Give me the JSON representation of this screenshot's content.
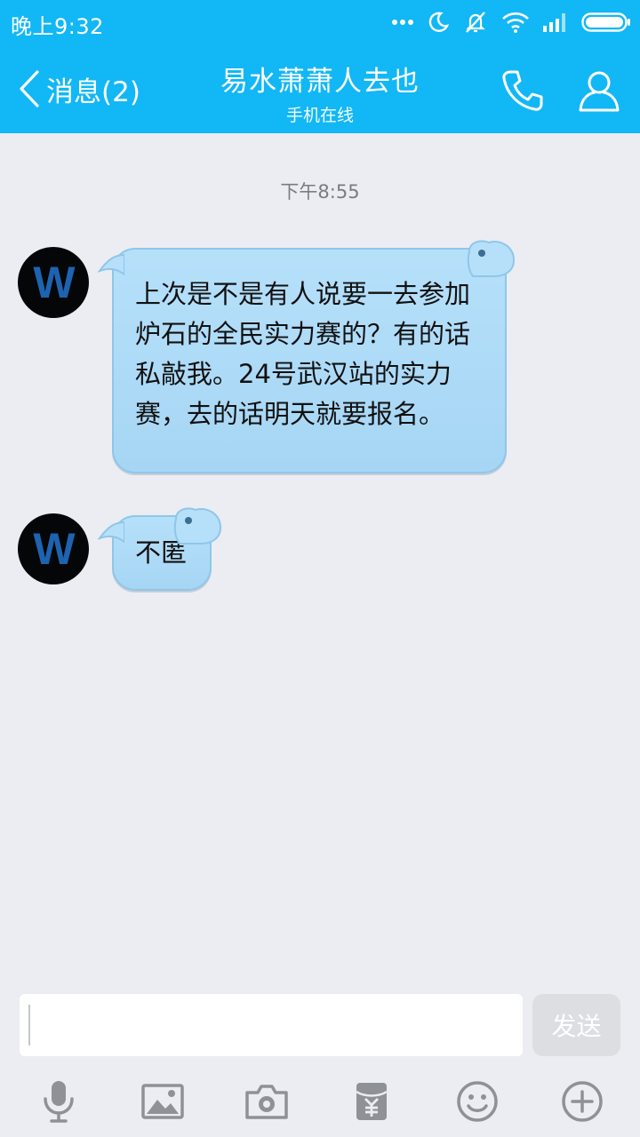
{
  "status_bar": {
    "time": "晚上9:32"
  },
  "header": {
    "back_label": "消息(2)",
    "title": "易水萧萧人去也",
    "subtitle": "手机在线"
  },
  "chat": {
    "timestamp": "下午8:55",
    "messages": [
      {
        "sender_initial": "W",
        "text": "上次是不是有人说要一去参加炉石的全民实力赛的？有的话私敲我。24号武汉站的实力赛，去的话明天就要报名。"
      },
      {
        "sender_initial": "W",
        "text": "不匿"
      }
    ]
  },
  "composer": {
    "input_value": "",
    "send_label": "发送"
  },
  "toolbar": {
    "items": [
      "microphone-icon",
      "image-icon",
      "camera-icon",
      "red-packet-icon",
      "emoji-icon",
      "plus-icon"
    ]
  },
  "colors": {
    "header_bg": "#12b7f5",
    "page_bg": "#ebedf2",
    "bubble_bg": "#a6d6f4",
    "icon_gray": "#8e9297"
  }
}
